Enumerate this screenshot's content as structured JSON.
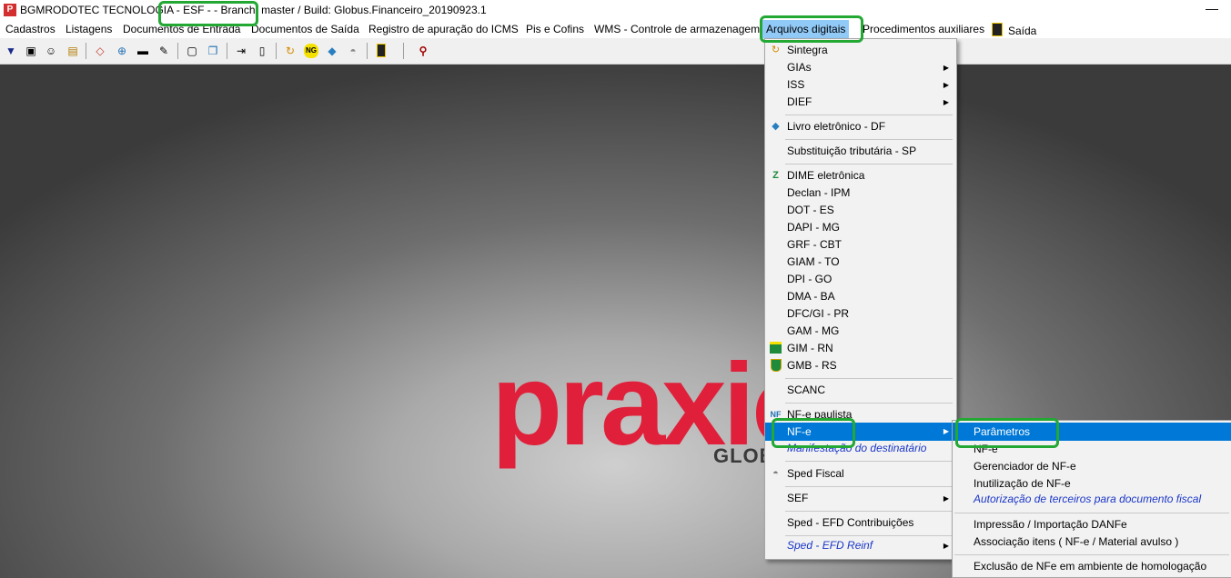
{
  "window": {
    "title": "BGMRODOTEC TECNOLOGIA  - ESF -  - Branch: master / Build: Globus.Financeiro_20190923.1",
    "minimize_glyph": "—"
  },
  "menubar": {
    "items": [
      "Cadastros",
      "Listagens",
      "Documentos de Entrada",
      "Documentos de Saída",
      "Registro de apuração do ICMS",
      "Pis e Cofins",
      "WMS - Controle de armazenagem",
      "Arquivos digitais",
      "Procedimentos auxiliares",
      "Saída"
    ],
    "active": "Arquivos digitais"
  },
  "toolbar": {
    "icons": [
      "down-arrow-icon",
      "window-icon",
      "user-icon",
      "folder-icon",
      "tag-icon",
      "cart-icon",
      "truck-icon",
      "note-icon",
      "document-icon",
      "copy-icon",
      "export-icon",
      "page-icon",
      "sintegra-icon",
      "ng-icon",
      "book-icon",
      "shield-icon",
      "exit-icon",
      "search-icon"
    ],
    "ng_label": "NG"
  },
  "logo": {
    "word": "praxio",
    "sub": "GLOBUS"
  },
  "dropdown": {
    "items": [
      {
        "label": "Sintegra",
        "icon": "sintegra-icon",
        "submenu": false
      },
      {
        "label": "GIAs",
        "submenu": true
      },
      {
        "label": "ISS",
        "submenu": true
      },
      {
        "label": "DIEF",
        "submenu": true
      },
      {
        "label": "Livro eletrônico - DF",
        "icon": "book-icon",
        "submenu": false
      },
      {
        "label": "Substituição tributária - SP",
        "submenu": false
      },
      {
        "label": "DIME eletrônica",
        "icon": "dime-icon",
        "submenu": false
      },
      {
        "label": "Declan - IPM",
        "submenu": false
      },
      {
        "label": "DOT - ES",
        "submenu": false
      },
      {
        "label": "DAPI - MG",
        "submenu": false
      },
      {
        "label": "GRF - CBT",
        "submenu": false
      },
      {
        "label": "GIAM - TO",
        "submenu": false
      },
      {
        "label": "DPI - GO",
        "submenu": false
      },
      {
        "label": "DMA - BA",
        "submenu": false
      },
      {
        "label": "DFC/GI - PR",
        "submenu": false
      },
      {
        "label": "GAM - MG",
        "submenu": false
      },
      {
        "label": "GIM - RN",
        "icon": "flag-rn-icon",
        "submenu": false
      },
      {
        "label": "GMB - RS",
        "icon": "flag-rs-icon",
        "submenu": false
      },
      {
        "label": "SCANC",
        "submenu": false
      },
      {
        "label": "NF-e paulista",
        "icon": "nfe-sp-icon",
        "submenu": false
      },
      {
        "label": "NF-e",
        "submenu": true,
        "highlighted": true
      },
      {
        "label": "Manifestação do destinatário",
        "submenu": false,
        "italic": true
      },
      {
        "label": "Sped Fiscal",
        "icon": "sped-icon",
        "submenu": false
      },
      {
        "label": "SEF",
        "submenu": true
      },
      {
        "label": "Sped - EFD Contribuições",
        "submenu": false
      },
      {
        "label": "Sped - EFD Reinf",
        "submenu": true,
        "italic": true
      }
    ]
  },
  "submenu_nfe": {
    "items": [
      {
        "label": "Parâmetros",
        "highlighted": true
      },
      {
        "label": "NF-e"
      },
      {
        "label": "Gerenciador de NF-e"
      },
      {
        "label": "Inutilização de NF-e"
      },
      {
        "label": "Autorização de terceiros para documento fiscal",
        "italic": true
      },
      {
        "label": "Impressão / Importação DANFe"
      },
      {
        "label": "Associação itens ( NF-e / Material avulso )"
      },
      {
        "label": "Exclusão de NFe em ambiente de homologação"
      }
    ]
  },
  "colors": {
    "highlight": "#0078d7",
    "annotation": "#22a833",
    "logo": "#e0203a"
  }
}
